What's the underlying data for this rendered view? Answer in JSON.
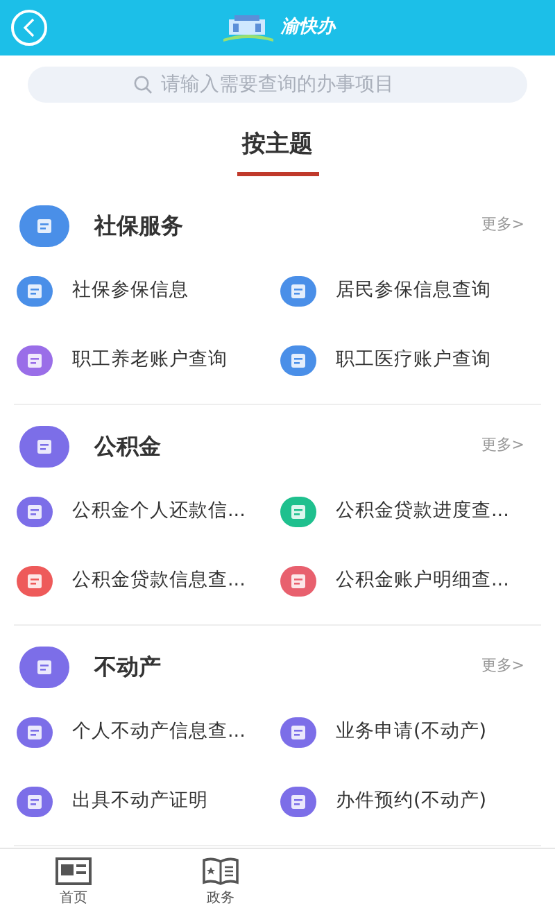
{
  "header": {
    "logo_text": "渝快办"
  },
  "search": {
    "placeholder": "请输入需要查询的办事项目"
  },
  "tabs": [
    {
      "label": "按主题",
      "selected": true
    }
  ],
  "sections": [
    {
      "title": "社保服务",
      "color": "#4a8fe8",
      "more": "更多>",
      "items": [
        {
          "label": "社保参保信息",
          "color": "#4a8fe8"
        },
        {
          "label": "居民参保信息查询",
          "color": "#4a8fe8"
        },
        {
          "label": "职工养老账户查询",
          "color": "#9a6ee8"
        },
        {
          "label": "职工医疗账户查询",
          "color": "#4a8fe8"
        }
      ]
    },
    {
      "title": "公积金",
      "color": "#7c6ee8",
      "more": "更多>",
      "items": [
        {
          "label": "公积金个人还款信...",
          "color": "#7c6ee8"
        },
        {
          "label": "公积金贷款进度查...",
          "color": "#1fc08e"
        },
        {
          "label": "公积金贷款信息查...",
          "color": "#ee5a5a"
        },
        {
          "label": "公积金账户明细查...",
          "color": "#e8606e"
        }
      ]
    },
    {
      "title": "不动产",
      "color": "#7c6ee8",
      "more": "更多>",
      "items": [
        {
          "label": "个人不动产信息查...",
          "color": "#7c6ee8"
        },
        {
          "label": "业务申请(不动产)",
          "color": "#7c6ee8"
        },
        {
          "label": "出具不动产证明",
          "color": "#7c6ee8"
        },
        {
          "label": "办件预约(不动产)",
          "color": "#7c6ee8"
        }
      ]
    }
  ],
  "bottom_nav": [
    {
      "kind": "home",
      "label": "首页"
    },
    {
      "kind": "affairs",
      "label": "政务"
    }
  ]
}
